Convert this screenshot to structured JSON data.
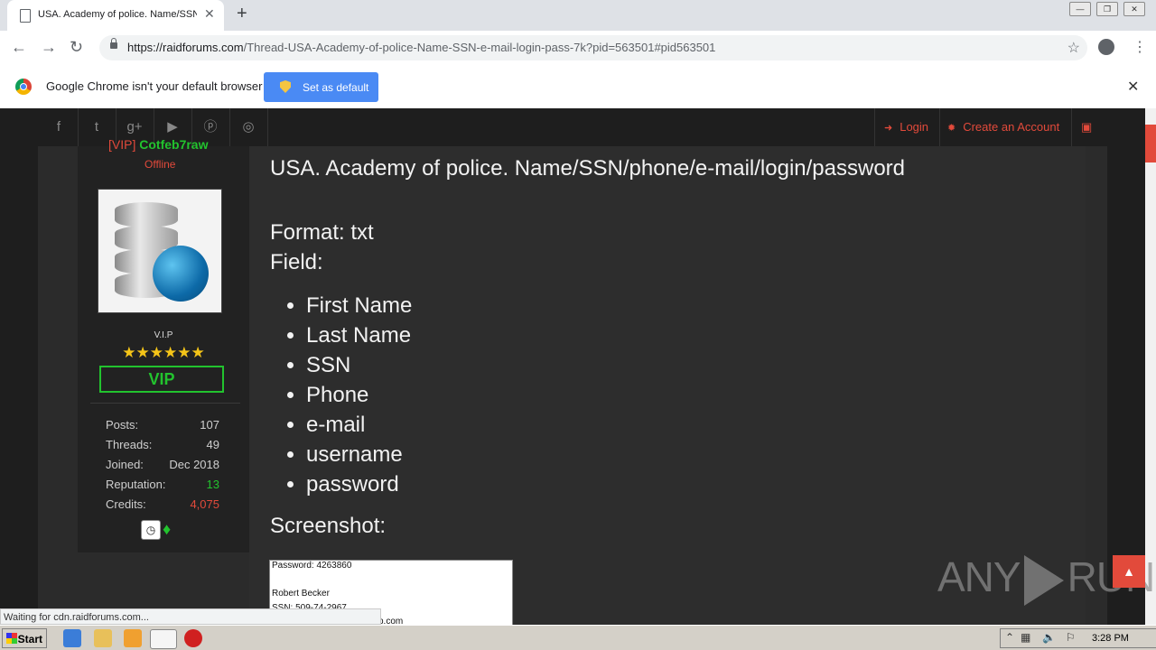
{
  "browser": {
    "tab_title": "USA. Academy of police. Name/SSN/",
    "url_host": "https://raidforums.com",
    "url_path": "/Thread-USA-Academy-of-police-Name-SSN-e-mail-login-pass-7k?pid=563501#pid563501",
    "infobar_text": "Google Chrome isn't your default browser",
    "set_default_label": "Set as default",
    "status_text": "Waiting for cdn.raidforums.com..."
  },
  "sitenav": {
    "login_label": "Login",
    "register_label": "Create an Account"
  },
  "profile": {
    "username_tag": "[VIP]",
    "username": "Cotfeb7raw",
    "status": "Offline",
    "rank": "V.I.P",
    "stars": "★★★★★★",
    "badge": "VIP",
    "stats": [
      {
        "label": "Posts:",
        "value": "107"
      },
      {
        "label": "Threads:",
        "value": "49"
      },
      {
        "label": "Joined:",
        "value": "Dec 2018"
      },
      {
        "label": "Reputation:",
        "value": "13"
      },
      {
        "label": "Credits:",
        "value": "4,075"
      }
    ]
  },
  "post": {
    "title": "USA. Academy of police. Name/SSN/phone/e-mail/login/password",
    "format": "Format: txt",
    "field_label": "Field:",
    "fields": [
      "First Name",
      "Last Name",
      "SSN",
      "Phone",
      "e-mail",
      "username",
      "password"
    ],
    "screenshot_label": "Screenshot:",
    "screenshot_lines": [
      "Password: 4263860",
      "Robert Becker",
      "SSN: 509-74-2967",
      "p.com"
    ]
  },
  "watermark": {
    "left": "ANY",
    "right": "RUN"
  },
  "taskbar": {
    "start_label": "Start",
    "clock": "3:28 PM"
  },
  "colors": {
    "accent": "#e24a3b",
    "vip_green": "#22c32e",
    "chrome_blue": "#4a8af4"
  }
}
